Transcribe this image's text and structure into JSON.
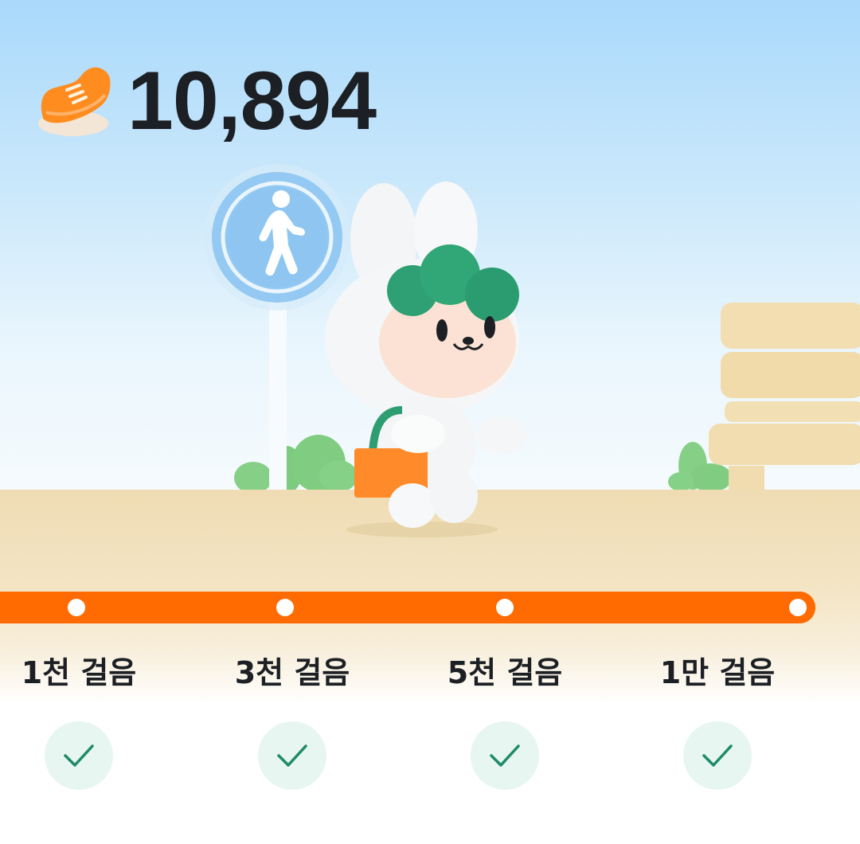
{
  "step_counter": {
    "icon": "sneaker-icon",
    "count": "10,894"
  },
  "progress": {
    "accent_color": "#ff6b00",
    "fraction": 1.0,
    "milestones": [
      {
        "label": "1천 걸음",
        "achieved": true
      },
      {
        "label": "3천 걸음",
        "achieved": true
      },
      {
        "label": "5천 걸음",
        "achieved": true
      },
      {
        "label": "1만 걸음",
        "achieved": true
      }
    ]
  },
  "illustration": {
    "sign_icon": "pedestrian-sign-icon",
    "character": "bunny-character",
    "bench": "bench",
    "check_color": "#1e8a6a"
  }
}
